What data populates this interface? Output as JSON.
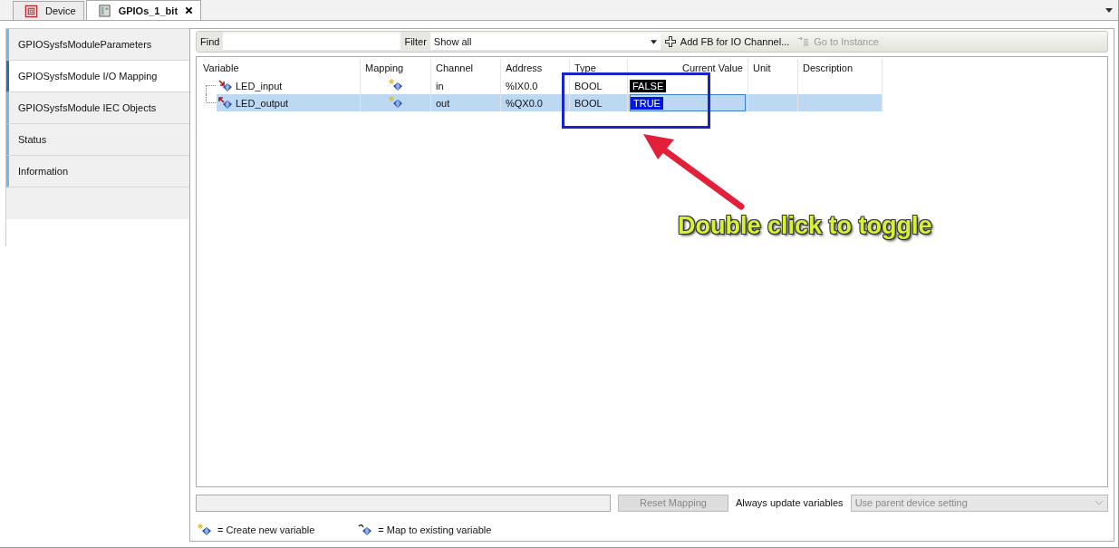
{
  "tabs": [
    {
      "label": "Device",
      "kind": "device",
      "selected": false,
      "closable": false
    },
    {
      "label": "GPIOs_1_bit",
      "kind": "module",
      "selected": true,
      "closable": true
    }
  ],
  "sidebar": {
    "items": [
      {
        "label": "GPIOSysfsModuleParameters",
        "selected": false
      },
      {
        "label": "GPIOSysfsModule I/O Mapping",
        "selected": true
      },
      {
        "label": "GPIOSysfsModule IEC Objects",
        "selected": false
      },
      {
        "label": "Status",
        "selected": false
      },
      {
        "label": "Information",
        "selected": false
      }
    ]
  },
  "toolbar": {
    "find_label": "Find",
    "filter_label": "Filter",
    "filter_value": "Show all",
    "add_button": "Add FB for IO Channel...",
    "goto_button": {
      "label": "Go to Instance",
      "disabled": true
    }
  },
  "table": {
    "columns": [
      "Variable",
      "Mapping",
      "Channel",
      "Address",
      "Type",
      "Current Value",
      "Unit",
      "Description"
    ],
    "rows": [
      {
        "variable": "LED_input",
        "kind": "input",
        "channel": "in",
        "address": "%IX0.0",
        "type": "BOOL",
        "current_value": "FALSE",
        "selected": false,
        "editing": false
      },
      {
        "variable": "LED_output",
        "kind": "output",
        "channel": "out",
        "address": "%QX0.0",
        "type": "BOOL",
        "current_value": "TRUE",
        "selected": true,
        "editing": true
      }
    ]
  },
  "bottom": {
    "reset_button": {
      "label": "Reset Mapping",
      "disabled": true
    },
    "update_label": "Always update variables",
    "update_value": {
      "label": "Use parent device setting",
      "disabled": true
    }
  },
  "legend": [
    {
      "kind": "create",
      "label": "= Create new variable"
    },
    {
      "kind": "map",
      "label": "= Map to existing variable"
    }
  ],
  "annotation": {
    "text": "Double click to toggle"
  }
}
